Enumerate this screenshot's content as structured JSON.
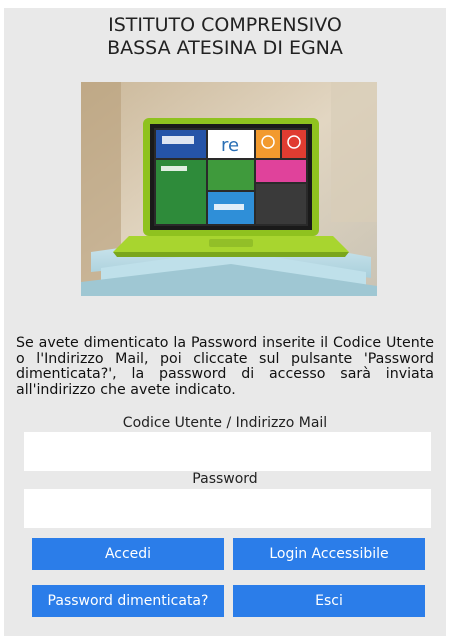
{
  "header": {
    "title_line1": "ISTITUTO COMPRENSIVO",
    "title_line2": "BASSA ATESINA DI EGNA"
  },
  "hero_image": {
    "screen_tiles": [
      "CLASSEVIVA",
      "re",
      "?",
      "?",
      "Scuola 365",
      "classroom"
    ],
    "laptop_color": "#9acd32"
  },
  "instructions": "Se avete dimenticato la Password inserite il Codice Utente o l'Indirizzo Mail, poi cliccate sul pulsante 'Password dimenticata?', la password di accesso sarà inviata all'indirizzo che avete indicato.",
  "form": {
    "user_label": "Codice Utente / Indirizzo Mail",
    "user_value": "",
    "password_label": "Password",
    "password_value": ""
  },
  "buttons": {
    "login": "Accedi",
    "accessible_login": "Login Accessibile",
    "forgot_password": "Password dimenticata?",
    "exit": "Esci"
  },
  "colors": {
    "panel_bg": "#e9e9e9",
    "button_bg": "#2b7de9",
    "button_text": "#ffffff"
  }
}
